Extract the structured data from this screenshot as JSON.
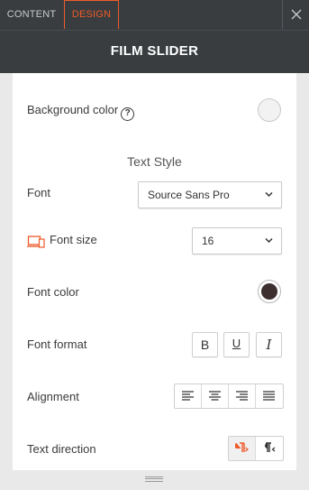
{
  "tabs": {
    "content_label": "CONTENT",
    "design_label": "DESIGN"
  },
  "panel_title": "FILM SLIDER",
  "background_color": {
    "label": "Background color",
    "help_symbol": "?"
  },
  "text_style": {
    "section_title": "Text Style",
    "font": {
      "label": "Font",
      "value": "Source Sans Pro"
    },
    "font_size": {
      "label": "Font size",
      "value": "16"
    },
    "font_color": {
      "label": "Font color",
      "value": "#3d2f2f"
    },
    "font_format": {
      "label": "Font format",
      "bold": "B",
      "underline": "U",
      "italic": "I"
    },
    "alignment": {
      "label": "Alignment",
      "options": [
        "left",
        "center",
        "right",
        "justify"
      ]
    },
    "text_direction": {
      "label": "Text direction",
      "selected": "ltr"
    }
  },
  "colors": {
    "accent": "#ee5a2a",
    "header_bg": "#393d40",
    "font_color_swatch": "#3d2f2f"
  }
}
